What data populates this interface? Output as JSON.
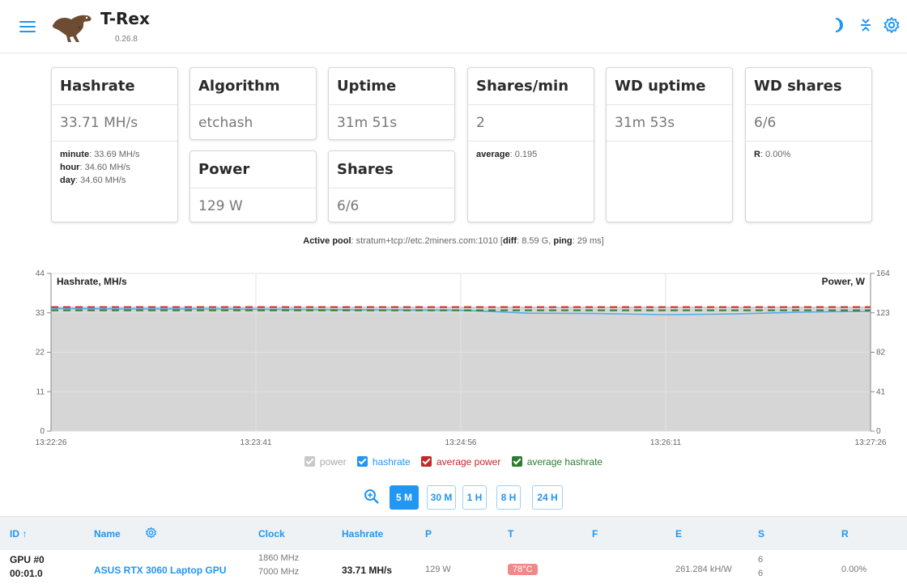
{
  "header": {
    "title": "T-Rex",
    "version": "0.26.8",
    "accent": "#2196f3"
  },
  "cards": {
    "hashrate": {
      "title": "Hashrate",
      "value": "33.71 MH/s",
      "details": [
        {
          "k": "minute",
          "v": "33.69 MH/s"
        },
        {
          "k": "hour",
          "v": "34.60 MH/s"
        },
        {
          "k": "day",
          "v": "34.60 MH/s"
        }
      ]
    },
    "algorithm": {
      "title": "Algorithm",
      "value": "etchash"
    },
    "power": {
      "title": "Power",
      "value": "129 W"
    },
    "uptime": {
      "title": "Uptime",
      "value": "31m 51s"
    },
    "shares": {
      "title": "Shares",
      "value": "6/6"
    },
    "shares_min": {
      "title": "Shares/min",
      "value": "2",
      "avg_k": "average",
      "avg_v": "0.195"
    },
    "wd_uptime": {
      "title": "WD uptime",
      "value": "31m 53s"
    },
    "wd_shares": {
      "title": "WD shares",
      "value": "6/6",
      "r_k": "R",
      "r_v": "0.00%"
    }
  },
  "pool": {
    "label": "Active pool",
    "url": "stratum+tcp://etc.2miners.com:1010",
    "diff_label": "diff",
    "diff": "8.59 G",
    "ping_label": "ping",
    "ping": "29 ms"
  },
  "chart_data": {
    "type": "area",
    "ylabel_left": "Hashrate, MH/s",
    "ylabel_right": "Power, W",
    "y_left_ticks": [
      0,
      11,
      22,
      33,
      44
    ],
    "y_right_ticks": [
      0,
      41,
      82,
      123,
      164
    ],
    "ylim_left": [
      0,
      44
    ],
    "ylim_right": [
      0,
      164
    ],
    "x_ticks": [
      "13:22:26",
      "13:23:41",
      "13:24:56",
      "13:26:11",
      "13:27:26"
    ],
    "grid": true,
    "legend_position": "bottom",
    "series": [
      {
        "name": "power",
        "axis": "right",
        "color": "#cfcfcf",
        "values": [
          129,
          129,
          129,
          129,
          129,
          129,
          129,
          129,
          129,
          129,
          129,
          129,
          129
        ]
      },
      {
        "name": "hashrate",
        "axis": "left",
        "color": "#5aa9e6",
        "values": [
          34.2,
          34.1,
          34.1,
          34.0,
          33.9,
          33.8,
          33.7,
          32.9,
          32.8,
          32.5,
          32.7,
          33.2,
          33.4
        ]
      },
      {
        "name": "average power",
        "axis": "right",
        "color": "#c62828",
        "dashed": true,
        "value": 129
      },
      {
        "name": "average hashrate",
        "axis": "left",
        "color": "#2e7d32",
        "dashed": true,
        "value": 33.71
      }
    ],
    "legend_colors": [
      "#bdbdbd",
      "#2196f3",
      "#c62828",
      "#2e7d32"
    ]
  },
  "ranges": [
    "5 M",
    "30 M",
    "1 H",
    "8 H",
    "24 H"
  ],
  "table": {
    "headers": [
      "ID ↑",
      "Name",
      "Clock",
      "Hashrate",
      "P",
      "T",
      "F",
      "E",
      "S",
      "R"
    ],
    "row": {
      "id_line1": "GPU #0",
      "id_line2": "00:01.0",
      "name": "ASUS RTX 3060 Laptop GPU",
      "clock_core": "1860 MHz",
      "clock_mem": "7000 MHz",
      "hashrate": "33.71 MH/s",
      "power": "129 W",
      "temp": "78°C",
      "efficiency": "261.284 kH/W",
      "shares_a": "6",
      "shares_b": "6",
      "rejected": "0.00%"
    }
  }
}
